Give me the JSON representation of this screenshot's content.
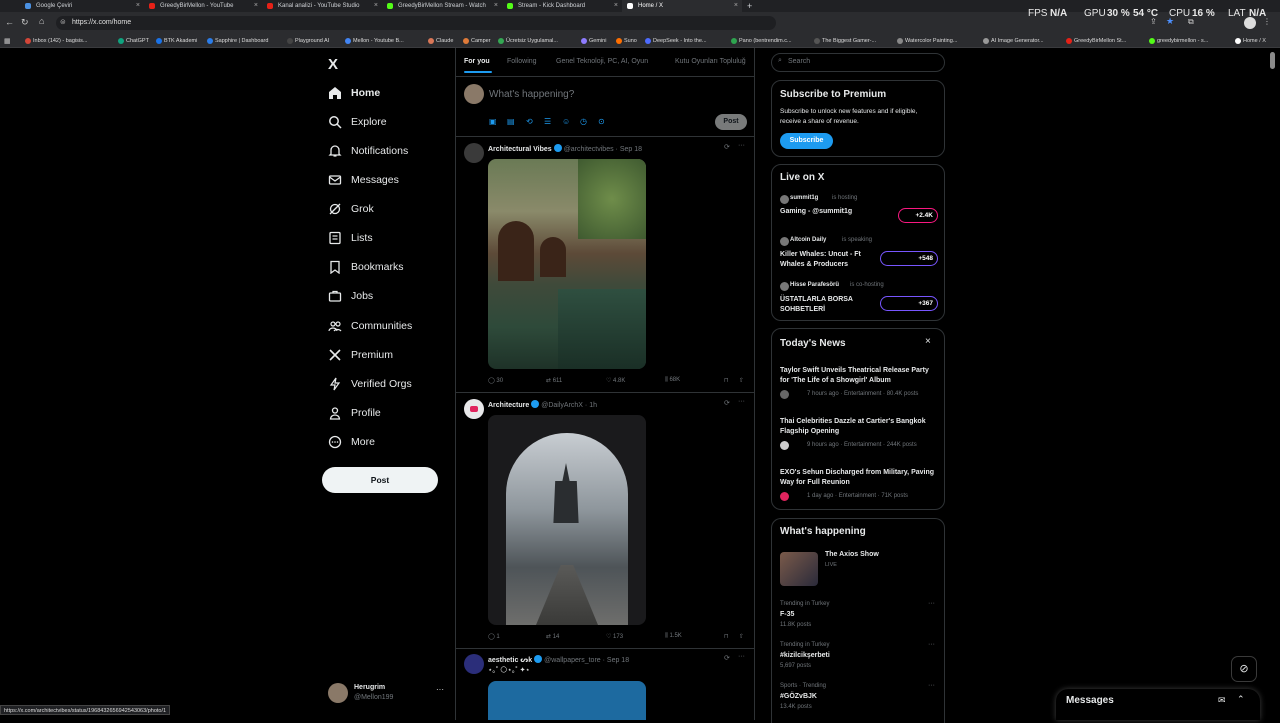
{
  "browser": {
    "tabs": [
      {
        "label": "Google Çeviri",
        "color": "#4a90e2"
      },
      {
        "label": "GreedyBirMellon - YouTube",
        "color": "#e62117"
      },
      {
        "label": "Kanal analizi - YouTube Studio",
        "color": "#e62117"
      },
      {
        "label": "GreedyBirMellon Stream - Watch",
        "color": "#53fc18"
      },
      {
        "label": "Stream - Kick Dashboard",
        "color": "#53fc18"
      },
      {
        "label": "Home / X",
        "color": "#ffffff"
      }
    ],
    "new_tab": "+",
    "url": "https://x.com/home",
    "bookmarks": [
      "Inbox (142) - bagisis...",
      "ChatGPT",
      "BTK Akademi",
      "Sapphire | Dashboard",
      "Playground AI",
      "Mellon - Youtube B...",
      "Claude",
      "Camper",
      "Ücretsiz Uygulamal...",
      "Gemini",
      "Suno",
      "DeepSeek - Into the...",
      "Pano (bentrendim.c...",
      "The Biggest Gamer-...",
      "Watercolor Painting...",
      "AI Image Generator...",
      "GreedyBirMellon St...",
      "greedybirmellon - s...",
      "Home / X"
    ],
    "status_url": "https://x.com/architectvibes/status/1968432656942543063/photo/1"
  },
  "perf": {
    "fps_label": "FPS",
    "fps_value": "N/A",
    "gpu_label": "GPU",
    "gpu_value": "30 %",
    "gpu_temp": "54 °C",
    "cpu_label": "CPU",
    "cpu_value": "16 %",
    "lat_label": "LAT",
    "lat_value": "N/A"
  },
  "sidebar": {
    "logo": "X",
    "items": [
      {
        "label": "Home",
        "icon": "home-icon"
      },
      {
        "label": "Explore",
        "icon": "search-icon"
      },
      {
        "label": "Notifications",
        "icon": "bell-icon"
      },
      {
        "label": "Messages",
        "icon": "envelope-icon"
      },
      {
        "label": "Grok",
        "icon": "grok-icon"
      },
      {
        "label": "Lists",
        "icon": "list-icon"
      },
      {
        "label": "Bookmarks",
        "icon": "bookmark-icon"
      },
      {
        "label": "Jobs",
        "icon": "briefcase-icon"
      },
      {
        "label": "Communities",
        "icon": "people-icon"
      },
      {
        "label": "Premium",
        "icon": "x-icon"
      },
      {
        "label": "Verified Orgs",
        "icon": "lightning-icon"
      },
      {
        "label": "Profile",
        "icon": "person-icon"
      },
      {
        "label": "More",
        "icon": "more-circle-icon"
      }
    ],
    "post_button": "Post",
    "account": {
      "name": "Herugrim",
      "handle": "@Mellon199",
      "more": "···"
    }
  },
  "feed": {
    "tabs": [
      "For you",
      "Following",
      "Genel Teknoloji, PC, AI, Oyun",
      "Kutu Oyunları Topluluğ"
    ],
    "composer": {
      "placeholder": "What's happening?",
      "post_label": "Post"
    },
    "tweets": [
      {
        "name": "Architectural Vibes",
        "handle": "@architectvibes",
        "time": "· Sep 18",
        "replies": "30",
        "reposts": "611",
        "likes": "4.8K",
        "views": "68K"
      },
      {
        "name": "Architecture",
        "handle": "@DailyArchX",
        "time": "· 1h",
        "replies": "1",
        "reposts": "14",
        "likes": "173",
        "views": "1.5K"
      },
      {
        "name": "aesthetic ᔕk",
        "handle": "@wallpapers_tore",
        "time": "· Sep 18",
        "text": "⋆｡˚ 🌕⋆｡˚ ✦⋆"
      }
    ]
  },
  "right": {
    "search_placeholder": "Search",
    "premium": {
      "title": "Subscribe to Premium",
      "body": "Subscribe to unlock new features and if eligible, receive a share of revenue.",
      "button": "Subscribe"
    },
    "live": {
      "title": "Live on X",
      "items": [
        {
          "host": "summit1g",
          "status": "is hosting",
          "title": "Gaming - @summit1g",
          "count": "+2.4K",
          "border": "#f91880"
        },
        {
          "host": "Altcoin Daily",
          "status": "is speaking",
          "title": "Killer Whales: Uncut - Ft Whales & Producers",
          "count": "+548",
          "border": "#7856ff"
        },
        {
          "host": "Hisse Parafesörü",
          "status": "is co-hosting",
          "title": "ÜSTATLARLA BORSA SOHBETLERİ",
          "count": "+367",
          "border": "#7856ff"
        }
      ]
    },
    "news": {
      "title": "Today's News",
      "close": "×",
      "items": [
        {
          "title": "Taylor Swift Unveils Theatrical Release Party for 'The Life of a Showgirl' Album",
          "meta": "7 hours ago · Entertainment · 80.4K posts"
        },
        {
          "title": "Thai Celebrities Dazzle at Cartier's Bangkok Flagship Opening",
          "meta": "9 hours ago · Entertainment · 244K posts"
        },
        {
          "title": "EXO's Sehun Discharged from Military, Paving Way for Full Reunion",
          "meta": "1 day ago · Entertainment · 71K posts"
        }
      ]
    },
    "happening": {
      "title": "What's happening",
      "show": {
        "title": "The Axios Show",
        "status": "LIVE"
      },
      "trends": [
        {
          "context": "Trending in Turkey",
          "name": "F-35",
          "posts": "11.8K posts"
        },
        {
          "context": "Trending in Turkey",
          "name": "#kizilcikşerbeti",
          "posts": "5,697 posts"
        },
        {
          "context": "Sports · Trending",
          "name": "#GÖZvBJK",
          "posts": "13.4K posts"
        }
      ]
    },
    "messages_label": "Messages"
  }
}
